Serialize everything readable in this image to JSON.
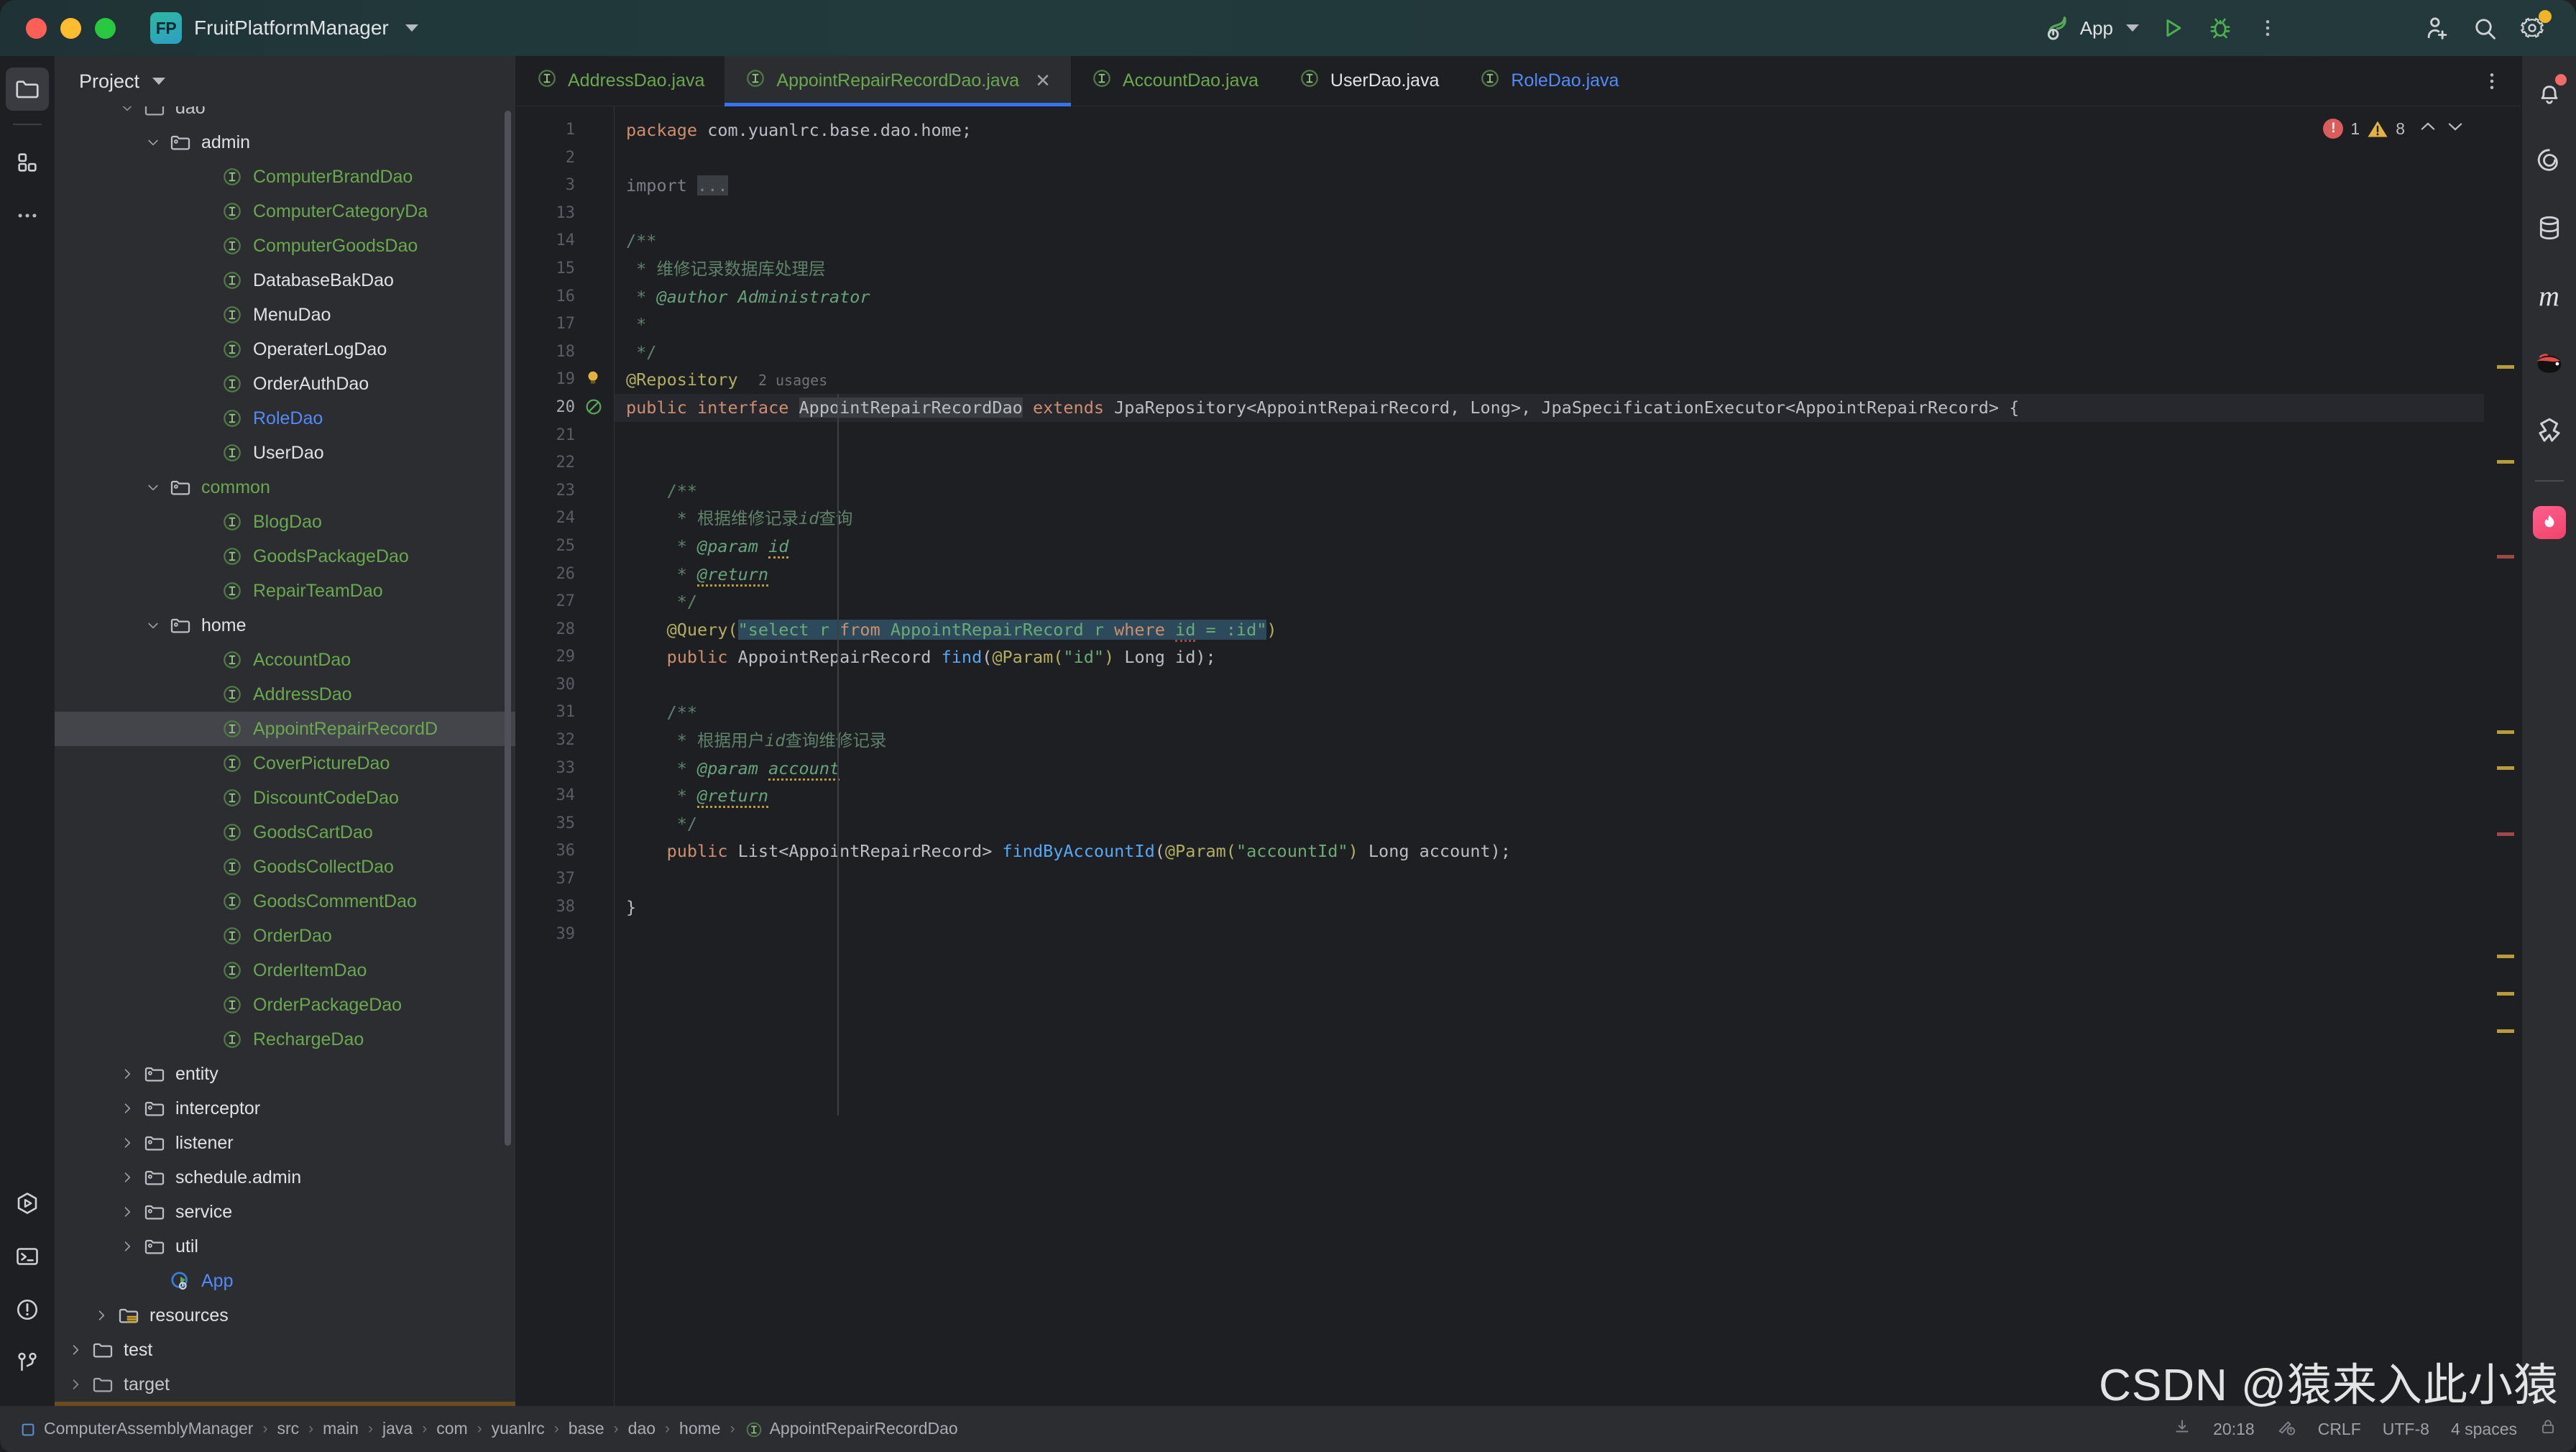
{
  "window": {
    "project_badge": "FP",
    "project_name": "FruitPlatformManager",
    "traffic_lights": [
      "close",
      "minimize",
      "maximize"
    ]
  },
  "toolbar": {
    "run_config": "App",
    "run_button": "run-icon",
    "debug_button": "debug-icon",
    "more_button": "more-vertical-icon",
    "account_button": "account-add-icon",
    "search_button": "search-icon",
    "settings_button": "settings-gear-icon"
  },
  "left_strip": {
    "items": [
      {
        "name": "project-tool-window",
        "icon": "folder-icon",
        "active": true
      },
      {
        "name": "commit-tool-window",
        "icon": "grid-squares-icon",
        "active": false
      },
      {
        "name": "more-tool-windows",
        "icon": "ellipsis-icon",
        "active": false
      }
    ],
    "bottom_items": [
      {
        "name": "run-tool-window",
        "icon": "run-hex-icon"
      },
      {
        "name": "terminal-tool-window",
        "icon": "terminal-icon"
      },
      {
        "name": "problems-tool-window",
        "icon": "warning-circle-icon"
      },
      {
        "name": "version-control-tool-window",
        "icon": "git-branch-icon"
      }
    ]
  },
  "project_panel": {
    "header": "Project",
    "header_chevron": "chevron-down-icon",
    "tree": [
      {
        "label": "dao",
        "type": "folder",
        "indent": 3,
        "color": "white",
        "arrow": "down",
        "clipped": true
      },
      {
        "label": "admin",
        "type": "package",
        "indent": 4,
        "color": "white",
        "arrow": "down"
      },
      {
        "label": "ComputerBrandDao",
        "type": "interface",
        "indent": 6,
        "color": "green",
        "arrow": "none"
      },
      {
        "label": "ComputerCategoryDa",
        "type": "interface",
        "indent": 6,
        "color": "green",
        "arrow": "none"
      },
      {
        "label": "ComputerGoodsDao",
        "type": "interface",
        "indent": 6,
        "color": "green",
        "arrow": "none"
      },
      {
        "label": "DatabaseBakDao",
        "type": "interface",
        "indent": 6,
        "color": "white",
        "arrow": "none"
      },
      {
        "label": "MenuDao",
        "type": "interface",
        "indent": 6,
        "color": "white",
        "arrow": "none"
      },
      {
        "label": "OperaterLogDao",
        "type": "interface",
        "indent": 6,
        "color": "white",
        "arrow": "none"
      },
      {
        "label": "OrderAuthDao",
        "type": "interface",
        "indent": 6,
        "color": "white",
        "arrow": "none"
      },
      {
        "label": "RoleDao",
        "type": "interface",
        "indent": 6,
        "color": "blue",
        "arrow": "none"
      },
      {
        "label": "UserDao",
        "type": "interface",
        "indent": 6,
        "color": "white",
        "arrow": "none"
      },
      {
        "label": "common",
        "type": "package",
        "indent": 4,
        "color": "green",
        "arrow": "down"
      },
      {
        "label": "BlogDao",
        "type": "interface",
        "indent": 6,
        "color": "green",
        "arrow": "none"
      },
      {
        "label": "GoodsPackageDao",
        "type": "interface",
        "indent": 6,
        "color": "green",
        "arrow": "none"
      },
      {
        "label": "RepairTeamDao",
        "type": "interface",
        "indent": 6,
        "color": "green",
        "arrow": "none"
      },
      {
        "label": "home",
        "type": "package",
        "indent": 4,
        "color": "white",
        "arrow": "down"
      },
      {
        "label": "AccountDao",
        "type": "interface",
        "indent": 6,
        "color": "green",
        "arrow": "none"
      },
      {
        "label": "AddressDao",
        "type": "interface",
        "indent": 6,
        "color": "green",
        "arrow": "none"
      },
      {
        "label": "AppointRepairRecordD",
        "type": "interface",
        "indent": 6,
        "color": "green",
        "arrow": "none",
        "selected": true
      },
      {
        "label": "CoverPictureDao",
        "type": "interface",
        "indent": 6,
        "color": "green",
        "arrow": "none"
      },
      {
        "label": "DiscountCodeDao",
        "type": "interface",
        "indent": 6,
        "color": "green",
        "arrow": "none"
      },
      {
        "label": "GoodsCartDao",
        "type": "interface",
        "indent": 6,
        "color": "green",
        "arrow": "none"
      },
      {
        "label": "GoodsCollectDao",
        "type": "interface",
        "indent": 6,
        "color": "green",
        "arrow": "none"
      },
      {
        "label": "GoodsCommentDao",
        "type": "interface",
        "indent": 6,
        "color": "green",
        "arrow": "none"
      },
      {
        "label": "OrderDao",
        "type": "interface",
        "indent": 6,
        "color": "green",
        "arrow": "none"
      },
      {
        "label": "OrderItemDao",
        "type": "interface",
        "indent": 6,
        "color": "green",
        "arrow": "none"
      },
      {
        "label": "OrderPackageDao",
        "type": "interface",
        "indent": 6,
        "color": "green",
        "arrow": "none"
      },
      {
        "label": "RechargeDao",
        "type": "interface",
        "indent": 6,
        "color": "green",
        "arrow": "none"
      },
      {
        "label": "entity",
        "type": "package",
        "indent": 3,
        "color": "white",
        "arrow": "right"
      },
      {
        "label": "interceptor",
        "type": "package",
        "indent": 3,
        "color": "white",
        "arrow": "right"
      },
      {
        "label": "listener",
        "type": "package",
        "indent": 3,
        "color": "white",
        "arrow": "right"
      },
      {
        "label": "schedule.admin",
        "type": "package",
        "indent": 3,
        "color": "white",
        "arrow": "right"
      },
      {
        "label": "service",
        "type": "package",
        "indent": 3,
        "color": "white",
        "arrow": "right"
      },
      {
        "label": "util",
        "type": "package",
        "indent": 3,
        "color": "white",
        "arrow": "right"
      },
      {
        "label": "App",
        "type": "springboot-app",
        "indent": 4,
        "color": "blue",
        "arrow": "none"
      },
      {
        "label": "resources",
        "type": "resources-folder",
        "indent": 2,
        "color": "white",
        "arrow": "right"
      },
      {
        "label": "test",
        "type": "folder",
        "indent": 1,
        "color": "white",
        "arrow": "right"
      },
      {
        "label": "target",
        "type": "folder",
        "indent": 1,
        "color": "white",
        "arrow": "right",
        "clipped": true
      }
    ]
  },
  "tabs": [
    {
      "label": "AddressDao.java",
      "icon": "interface-icon",
      "color": "green",
      "active": false,
      "closable": false
    },
    {
      "label": "AppointRepairRecordDao.java",
      "icon": "interface-icon",
      "color": "green",
      "active": true,
      "closable": true
    },
    {
      "label": "AccountDao.java",
      "icon": "interface-icon",
      "color": "green",
      "active": false,
      "closable": false
    },
    {
      "label": "UserDao.java",
      "icon": "interface-icon",
      "color": "white",
      "active": false,
      "closable": false
    },
    {
      "label": "RoleDao.java",
      "icon": "interface-icon",
      "color": "blue",
      "active": false,
      "closable": false
    }
  ],
  "tabbar_more_icon": "more-vertical-icon",
  "inspections": {
    "error_count": "1",
    "warning_count": "8",
    "up_icon": "chevron-up-icon",
    "down_icon": "chevron-down-icon"
  },
  "editor": {
    "line_numbers": [
      1,
      2,
      3,
      13,
      14,
      15,
      16,
      17,
      18,
      19,
      20,
      21,
      22,
      23,
      24,
      25,
      26,
      27,
      28,
      29,
      30,
      31,
      32,
      33,
      34,
      35,
      36,
      37,
      38,
      39
    ],
    "current_line": 20,
    "usages_hint": "2 usages",
    "lines": [
      "package com.yuanlrc.base.dao.home;",
      "",
      "import ...",
      "",
      "/**",
      " * 维修记录数据库处理层",
      " * @author Administrator",
      " *",
      " */",
      "@Repository",
      "public interface AppointRepairRecordDao extends JpaRepository<AppointRepairRecord, Long>, JpaSpecificationExecutor<AppointRepairRecord> {",
      "",
      "",
      "    /**",
      "     * 根据维修记录id查询",
      "     * @param id",
      "     * @return",
      "     */",
      "    @Query(\"select r from AppointRepairRecord r where id = :id\")",
      "    public AppointRepairRecord find(@Param(\"id\") Long id);",
      "",
      "    /**",
      "     * 根据用户id查询维修记录",
      "     * @param account",
      "     * @return",
      "     */",
      "    public List<AppointRepairRecord> findByAccountId(@Param(\"accountId\") Long account);",
      "",
      "}",
      ""
    ]
  },
  "right_strip": {
    "items": [
      {
        "name": "notifications",
        "icon": "bell-icon",
        "has_badge": true
      },
      {
        "name": "spring",
        "icon": "spiral-icon",
        "has_badge": false
      },
      {
        "name": "database",
        "icon": "database-icon",
        "has_badge": false
      },
      {
        "name": "maven",
        "icon": "maven-m-icon",
        "has_badge": false
      },
      {
        "name": "ninja-plugin",
        "icon": "ninja-icon",
        "has_badge": false
      },
      {
        "name": "bundle-plugin",
        "icon": "bundle-icon",
        "has_badge": false
      },
      {
        "name": "ai-assistant",
        "icon": "ai-assistant-icon",
        "has_badge": false
      }
    ]
  },
  "status_bar": {
    "breadcrumbs": [
      {
        "label": "ComputerAssemblyManager",
        "icon": "module-icon"
      },
      {
        "label": "src",
        "icon": null
      },
      {
        "label": "main",
        "icon": null
      },
      {
        "label": "java",
        "icon": null
      },
      {
        "label": "com",
        "icon": null
      },
      {
        "label": "yuanlrc",
        "icon": null
      },
      {
        "label": "base",
        "icon": null
      },
      {
        "label": "dao",
        "icon": null
      },
      {
        "label": "home",
        "icon": null
      },
      {
        "label": "AppointRepairRecordDao",
        "icon": "interface-icon"
      }
    ],
    "separator": "›",
    "right": {
      "memory_icon": "download-indicator-icon",
      "time": "20:18",
      "inspection_icon": "inspection-level-icon",
      "line_separator": "CRLF",
      "encoding": "UTF-8",
      "indent": "4 spaces",
      "lock_icon": "lock-icon"
    }
  },
  "watermark": "CSDN @猿来入此小猿",
  "colors": {
    "accent_blue": "#3574f0",
    "tab_active_bg": "#2b2d30",
    "editor_bg": "#1e1f22",
    "panel_bg": "#2b2d30",
    "green_file": "#6aa84f",
    "blue_file": "#548af7",
    "error_red": "#db5c5c",
    "warning_yellow": "#e3b341"
  }
}
